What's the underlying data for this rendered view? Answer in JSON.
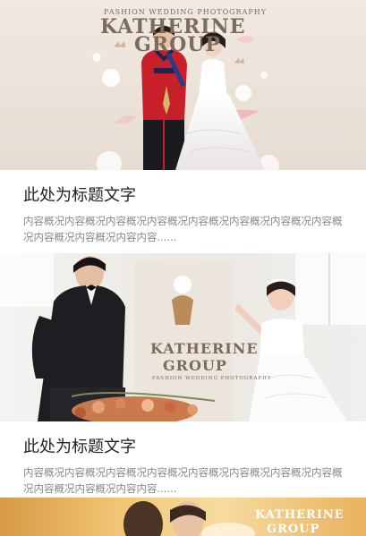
{
  "cards": [
    {
      "title": "此处为标题文字",
      "summary": "内容概况内容概况内容概况内容概况内容概况内容概况内容概况内容概况内容概况内容概况内容内容......",
      "logo": {
        "tagline": "FASHION WEDDING PHOTOGRAPHY",
        "line1": "KATHERINE",
        "line2": "GROUP"
      }
    },
    {
      "title": "此处为标题文字",
      "summary": "内容概况内容概况内容概况内容概况内容概况内容概况内容概况内容概况内容概况内容概况内容内容......",
      "logo": {
        "line1": "KATHERINE",
        "line2": "GROUP",
        "tagline": "FASHION WEDDING PHOTOGRAPHY"
      }
    },
    {
      "logo": {
        "line1": "KATHERINE",
        "line2": "GROUP"
      }
    }
  ],
  "colors": {
    "title": "#222222",
    "summary": "#888888",
    "logo": "#7d6b5b"
  }
}
